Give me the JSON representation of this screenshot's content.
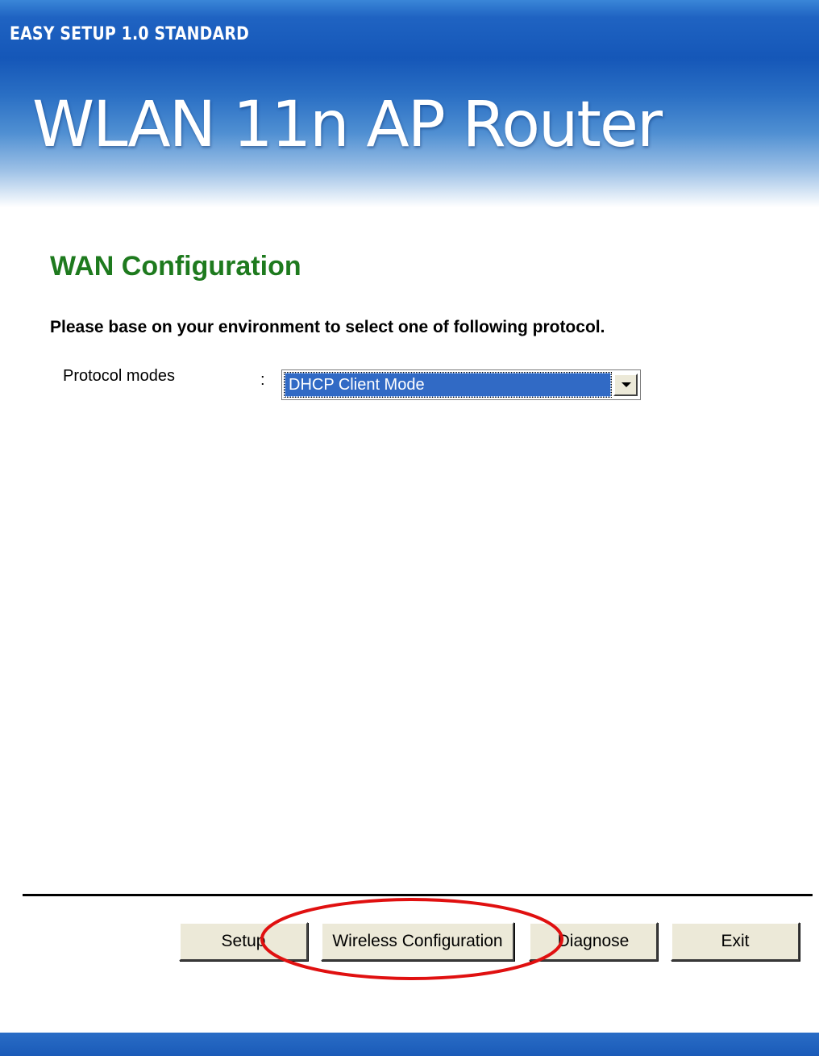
{
  "window": {
    "title": "EASY SETUP 1.0 STANDARD"
  },
  "banner": {
    "title": "WLAN 11n AP Router"
  },
  "section": {
    "title": "WAN Configuration",
    "instruction": "Please base on your environment to select one of following protocol."
  },
  "protocol": {
    "label": "Protocol modes",
    "separator": ":",
    "selected_value": "DHCP Client Mode"
  },
  "buttons": {
    "setup": "Setup",
    "wireless": "Wireless Configuration",
    "diagnose": "Diagnose",
    "exit": "Exit"
  },
  "annotation": {
    "highlight_color": "#e01010"
  }
}
